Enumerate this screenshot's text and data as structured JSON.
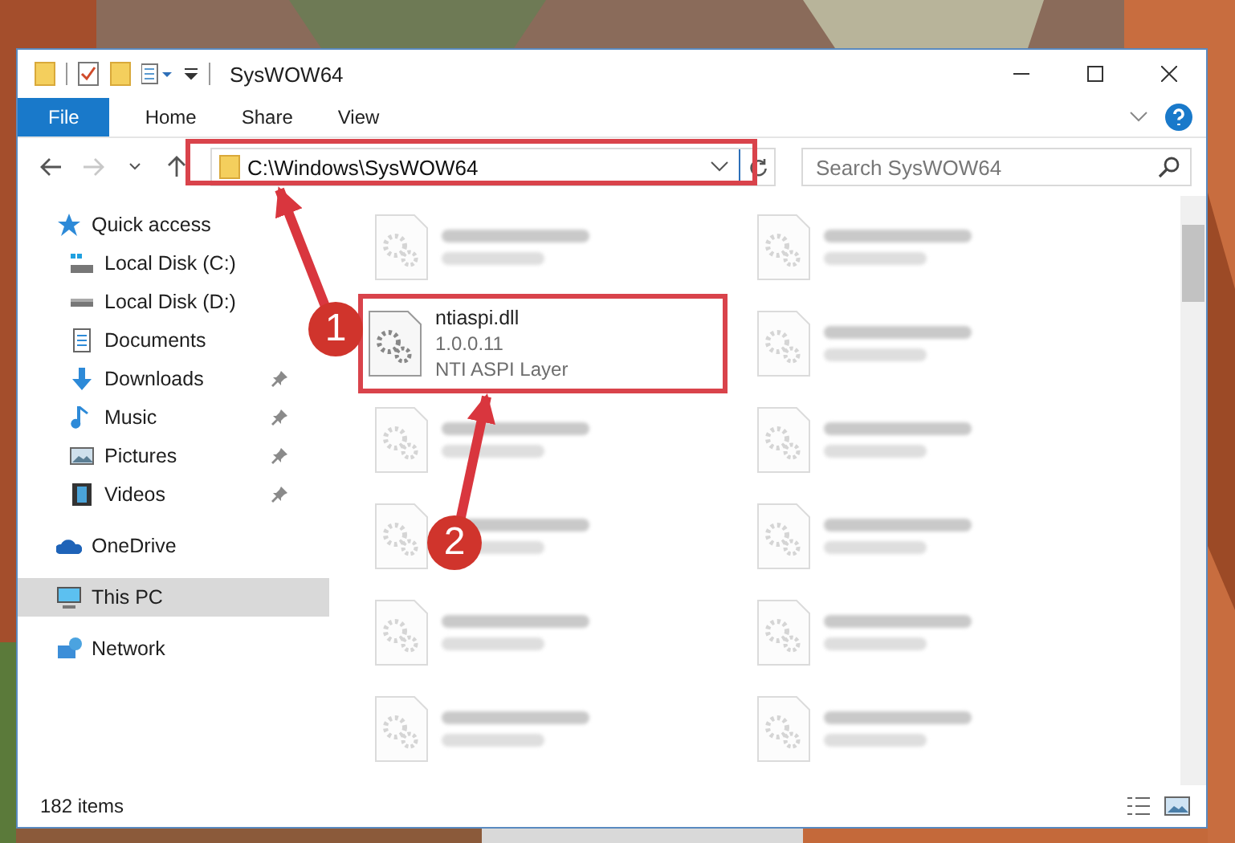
{
  "window": {
    "title": "SysWOW64"
  },
  "ribbon": {
    "tabs": [
      {
        "label": "File",
        "kind": "file"
      },
      {
        "label": "Home",
        "kind": "tab"
      },
      {
        "label": "Share",
        "kind": "tab"
      },
      {
        "label": "View",
        "kind": "tab"
      }
    ]
  },
  "address": {
    "path": "C:\\Windows\\SysWOW64"
  },
  "search": {
    "placeholder": "Search SysWOW64"
  },
  "sidebar": {
    "items": [
      {
        "label": "Quick access",
        "kind": "star",
        "selected": false,
        "children": [
          {
            "label": "Local Disk (C:)",
            "kind": "system-drive",
            "pinned": false,
            "selected": false
          },
          {
            "label": "Local Disk (D:)",
            "kind": "drive",
            "pinned": false,
            "selected": false
          },
          {
            "label": "Documents",
            "kind": "documents",
            "pinned": false,
            "selected": false
          },
          {
            "label": "Downloads",
            "kind": "downloads",
            "pinned": true,
            "selected": false
          },
          {
            "label": "Music",
            "kind": "music",
            "pinned": true,
            "selected": false
          },
          {
            "label": "Pictures",
            "kind": "pictures",
            "pinned": true,
            "selected": false
          },
          {
            "label": "Videos",
            "kind": "videos",
            "pinned": true,
            "selected": false
          }
        ]
      },
      {
        "label": "OneDrive",
        "kind": "cloud",
        "selected": false
      },
      {
        "label": "This PC",
        "kind": "pc",
        "selected": true
      },
      {
        "label": "Network",
        "kind": "network",
        "selected": false
      }
    ]
  },
  "files": [
    {
      "kind": "blurred"
    },
    {
      "kind": "blurred"
    },
    {
      "kind": "file",
      "name": "ntiaspi.dll",
      "details": [
        "1.0.0.11",
        "NTI ASPI Layer"
      ],
      "highlighted": true
    },
    {
      "kind": "blurred"
    },
    {
      "kind": "blurred"
    },
    {
      "kind": "blurred"
    },
    {
      "kind": "blurred"
    },
    {
      "kind": "blurred"
    },
    {
      "kind": "blurred"
    },
    {
      "kind": "blurred"
    },
    {
      "kind": "blurred"
    },
    {
      "kind": "blurred"
    }
  ],
  "status_bar": {
    "count": "182 items"
  },
  "callouts": [
    {
      "number": "1"
    },
    {
      "number": "2"
    }
  ]
}
